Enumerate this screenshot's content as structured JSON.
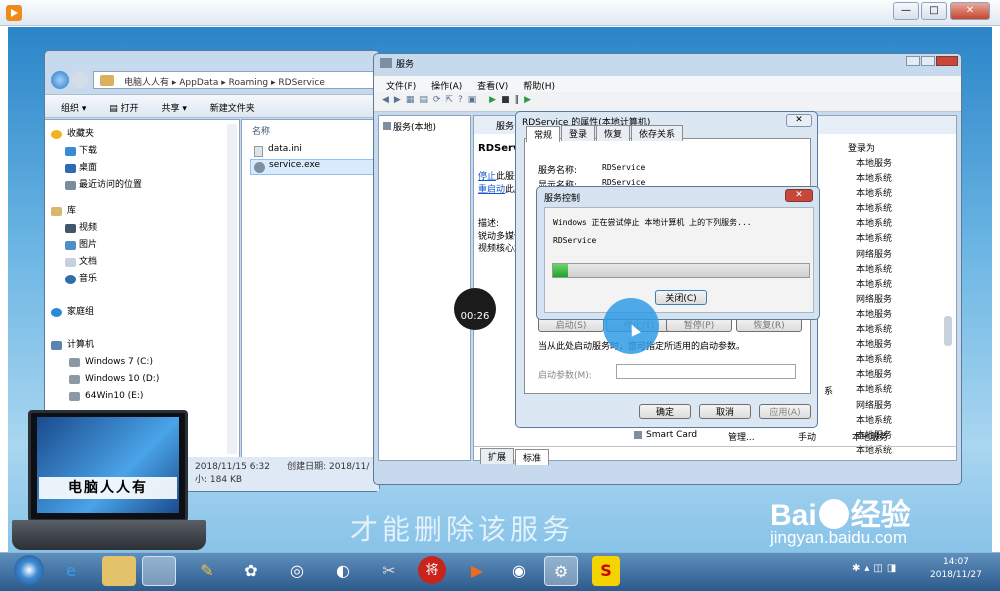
{
  "explorer": {
    "breadcrumb": [
      "电脑人人有",
      "AppData",
      "Roaming",
      "RDService"
    ],
    "toolbar": {
      "organize": "组织 ▾",
      "open": "打开",
      "share": "共享 ▾",
      "new_folder": "新建文件夹"
    },
    "sidebar": {
      "favorites": "收藏夹",
      "fav_items": [
        "下载",
        "桌面",
        "最近访问的位置"
      ],
      "libraries": "库",
      "lib_items": [
        "视频",
        "图片",
        "文档",
        "音乐"
      ],
      "homegroup": "家庭组",
      "computer": "计算机",
      "drives": [
        "Windows 7 (C:)",
        "Windows 10 (D:)",
        "64Win10 (E:)"
      ]
    },
    "column_header": "名称",
    "files": [
      "data.ini",
      "service.exe"
    ],
    "status_modified": "2018/11/15 6:32",
    "status_created_label": "创建日期: 2018/11/",
    "status_size": "184 KB",
    "status_size_label": "小:"
  },
  "services": {
    "title": "服务",
    "menu": [
      "文件(F)",
      "操作(A)",
      "查看(V)",
      "帮助(H)"
    ],
    "left_tree": "服务(本地)",
    "header_label": "服务",
    "detail_title": "RDService",
    "stop_link": "停止",
    "stop_rest": "此服务",
    "restart_link": "重启动",
    "restart_rest": "此服",
    "desc_label": "描述:",
    "desc_lines": [
      "锐动多媒体",
      "视频核心加"
    ],
    "logon_header": "登录为",
    "logon_values": [
      "本地服务",
      "本地系统",
      "本地系统",
      "本地系统",
      "本地系统",
      "本地系统",
      "网络服务",
      "本地系统",
      "本地系统",
      "网络服务",
      "本地服务",
      "本地系统",
      "本地服务",
      "本地系统",
      "本地服务",
      "本地系统",
      "网络服务",
      "本地系统",
      "本地服务",
      "本地系统"
    ],
    "smartcard_row": {
      "name": "Smart Card",
      "desc": "管理...",
      "start": "手动",
      "logon": "本地服务"
    },
    "partial_left": "动",
    "partial_left2": "系",
    "tabs": [
      "扩展",
      "标准"
    ]
  },
  "props": {
    "title": "RDService 的属性(本地计算机)",
    "tabs": [
      "常规",
      "登录",
      "恢复",
      "依存关系"
    ],
    "service_name_label": "服务名称:",
    "service_name": "RDService",
    "display_name_label": "显示名称:",
    "display_name": "RDService",
    "btn_start": "启动(S)",
    "btn_stop": "停止(T)",
    "btn_pause": "暂停(P)",
    "btn_resume": "恢复(R)",
    "hint": "当从此处启动服务时，您可指定所适用的启动参数。",
    "param_label": "启动参数(M):",
    "ok": "确定",
    "cancel": "取消",
    "apply": "应用(A)"
  },
  "control": {
    "title": "服务控制",
    "message": "Windows 正在尝试停止 本地计算机 上的下列服务...",
    "service": "RDService",
    "progress": 0.06,
    "close": "关闭(C)"
  },
  "timer": "00:26",
  "subtitle": "才能删除该服务",
  "logo_text": "电脑人人有",
  "baidu": {
    "text": "Bai",
    "text2": "经验",
    "url": "jingyan.baidu.com"
  },
  "clock": {
    "time": "14:07",
    "date": "2018/11/27"
  },
  "taskbar_icons": [
    "start-orb",
    "ie",
    "explorer-folder",
    "explorer-active",
    "paint",
    "app-ball",
    "media",
    "browser",
    "tools",
    "jiang",
    "player",
    "camera",
    "services-active",
    "sogou"
  ],
  "colors": {
    "accent": "#2f9be5",
    "progress": "#1fa32b"
  }
}
